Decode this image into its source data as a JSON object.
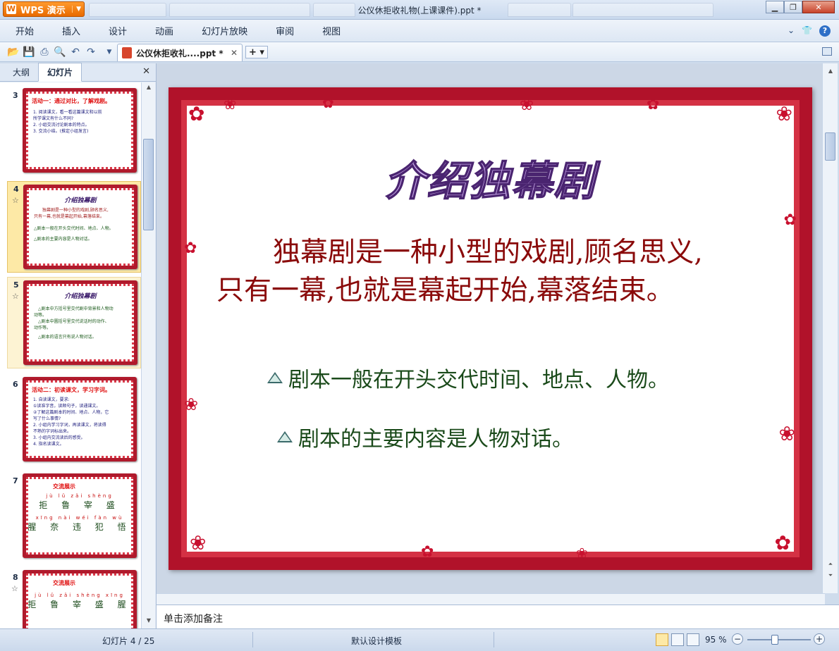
{
  "app": {
    "name": "WPS 演示",
    "window_title": "公仪休拒收礼物(上课课件).ppt *"
  },
  "menu": [
    "开始",
    "插入",
    "设计",
    "动画",
    "幻灯片放映",
    "审阅",
    "视图"
  ],
  "document_tab": {
    "label": "公仪休拒收礼....ppt *"
  },
  "panel": {
    "tabs": [
      "大纲",
      "幻灯片"
    ],
    "active_tab": "幻灯片"
  },
  "thumbnails": [
    {
      "number": "3",
      "title": "活动一：通过对比，了解戏剧。",
      "lines": [
        "1. 阅读课文，看一看这篇课文和以前",
        "所学课文有什么不同?",
        "2. 小组交流讨论剧本的特点。",
        "3. 交流小结。(推定小组发言)"
      ]
    },
    {
      "number": "4",
      "title": "介绍独幕剧",
      "lines": [
        "独幕剧是一种小型的戏剧,顾名思义,",
        "只有一幕,也就是幕起开始,幕落结束。",
        "△剧本一般在开头交代时间、地点、人物。",
        "△剧本的主要内容是人物对话。"
      ]
    },
    {
      "number": "5",
      "title": "介绍独幕剧",
      "lines": [
        "△剧本中方括号里交代剧中背景和人物动",
        "动等。",
        "△剧本中圆括号里交代说话时的动作、",
        "动作等。",
        "△剧本的语言只有说人物对话。"
      ]
    },
    {
      "number": "6",
      "title": "活动二：初读课文，学习字词。",
      "lines": [
        "1. 自读课文，要求:",
        "①读准字音，读顺句子，读通课文。",
        "②了解这篇剧本的时间、地点、人物，它",
        "写了什么事情?",
        "2. 小组内学习字词，再读课文，将读得",
        "不熟的字词标出来。",
        "3. 小组内交流读后的感受。",
        "4. 指名读课文。"
      ]
    },
    {
      "number": "7",
      "title": "交流展示",
      "pinyin1": "jù   lǔ   zǎi shèng",
      "chars1": "拒 鲁 宰 盛",
      "pinyin2": "xīng nài wéi fàn wù",
      "chars2": "腥 奈 违 犯 悟"
    },
    {
      "number": "8",
      "title": "交流展示",
      "pinyin1": "jù  lǔ  zǎi shèng xīng",
      "chars1": "拒 鲁 宰 盛 腥",
      "pinyin2": "",
      "chars2": ""
    }
  ],
  "current_slide": {
    "title": "介绍独幕剧",
    "body_line1": "独幕剧是一种小型的戏剧,顾名思义,",
    "body_line2": "只有一幕,也就是幕起开始,幕落结束。",
    "bullet1": "剧本一般在开头交代时间、地点、人物。",
    "bullet2": "剧本的主要内容是人物对话。"
  },
  "notes_placeholder": "单击添加备注",
  "status": {
    "slide_info": "幻灯片 4 / 25",
    "template": "默认设计模板",
    "zoom": "95 %"
  },
  "colors": {
    "accent": "#e86a00",
    "slide_border": "#b1122a",
    "body_text": "#8a0a0a",
    "bullet_text": "#1a4a1a"
  }
}
